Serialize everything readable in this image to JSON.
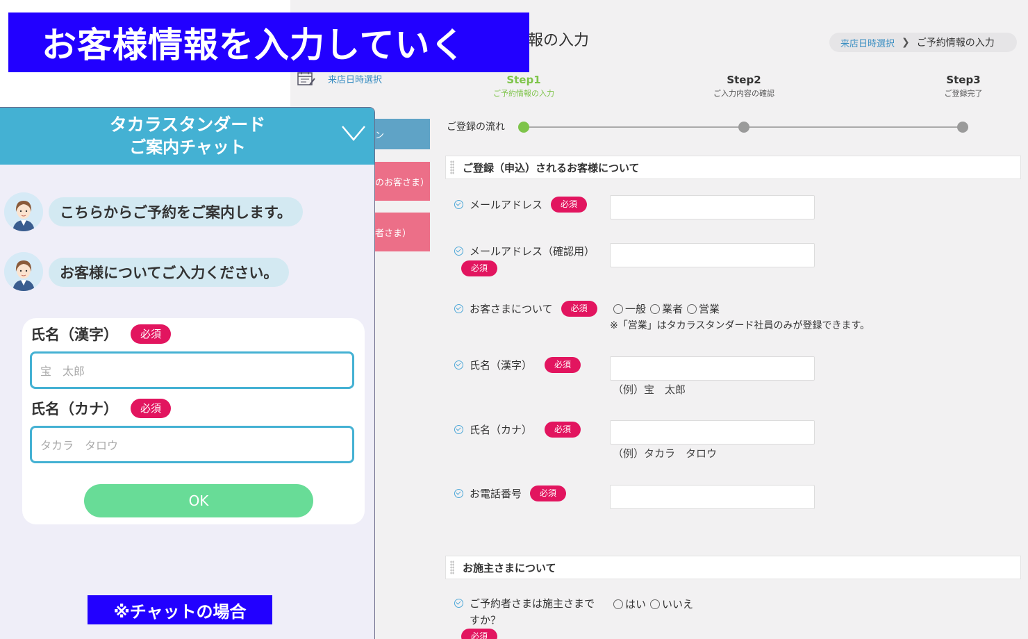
{
  "banner": {
    "text": "お客様情報を入力していく"
  },
  "page": {
    "title": "報の入力",
    "breadcrumb": {
      "link": "来店日時選択",
      "current": "ご予約情報の入力"
    },
    "calendar_link": "来店日時選択",
    "steps": [
      {
        "title": "Step1",
        "sub": "ご予約情報の入力"
      },
      {
        "title": "Step2",
        "sub": "ご入力内容の確認"
      },
      {
        "title": "Step3",
        "sub": "ご登録完了"
      }
    ],
    "flow_label": "ご登録の流れ",
    "side_buttons": {
      "blue": "ン",
      "pink1": "のお客さま）",
      "pink2": "者さま）"
    },
    "section1": "ご登録（申込）されるお客様について",
    "required_label": "必須",
    "fields": {
      "email": "メールアドレス",
      "email_confirm": "メールアドレス（確認用）",
      "customer_type": "お客さまについて",
      "name_kanji": "氏名（漢字）",
      "name_kana": "氏名（カナ）",
      "phone": "お電話番号"
    },
    "customer_options": [
      "一般",
      "業者",
      "営業"
    ],
    "customer_note": "※「営業」はタカラスタンダード社員のみが登録できます。",
    "name_kanji_hint": "（例）宝　太郎",
    "name_kana_hint": "（例）タカラ　タロウ",
    "section2": "お施主さまについて",
    "owner_question_line1": "ご予約者さまは施主さまで",
    "owner_question_line2": "すか？",
    "owner_options": [
      "はい",
      "いいえ"
    ]
  },
  "chat": {
    "title": "タカラスタンダード",
    "subtitle": "ご案内チャット",
    "messages": [
      "こちらからご予約をご案内します。",
      "お客様についてご入力ください。"
    ],
    "form": {
      "kanji_label": "氏名（漢字）",
      "kanji_placeholder": "宝　太郎",
      "kana_label": "氏名（カナ）",
      "kana_placeholder": "タカラ　タロウ",
      "required": "必須",
      "ok": "OK"
    },
    "note": "※チャットの場合"
  },
  "colors": {
    "banner": "#2200ff",
    "chat_header": "#44b1d3",
    "required": "#e2155f",
    "ok_button": "#68dc97",
    "step_active": "#7ec44a"
  }
}
